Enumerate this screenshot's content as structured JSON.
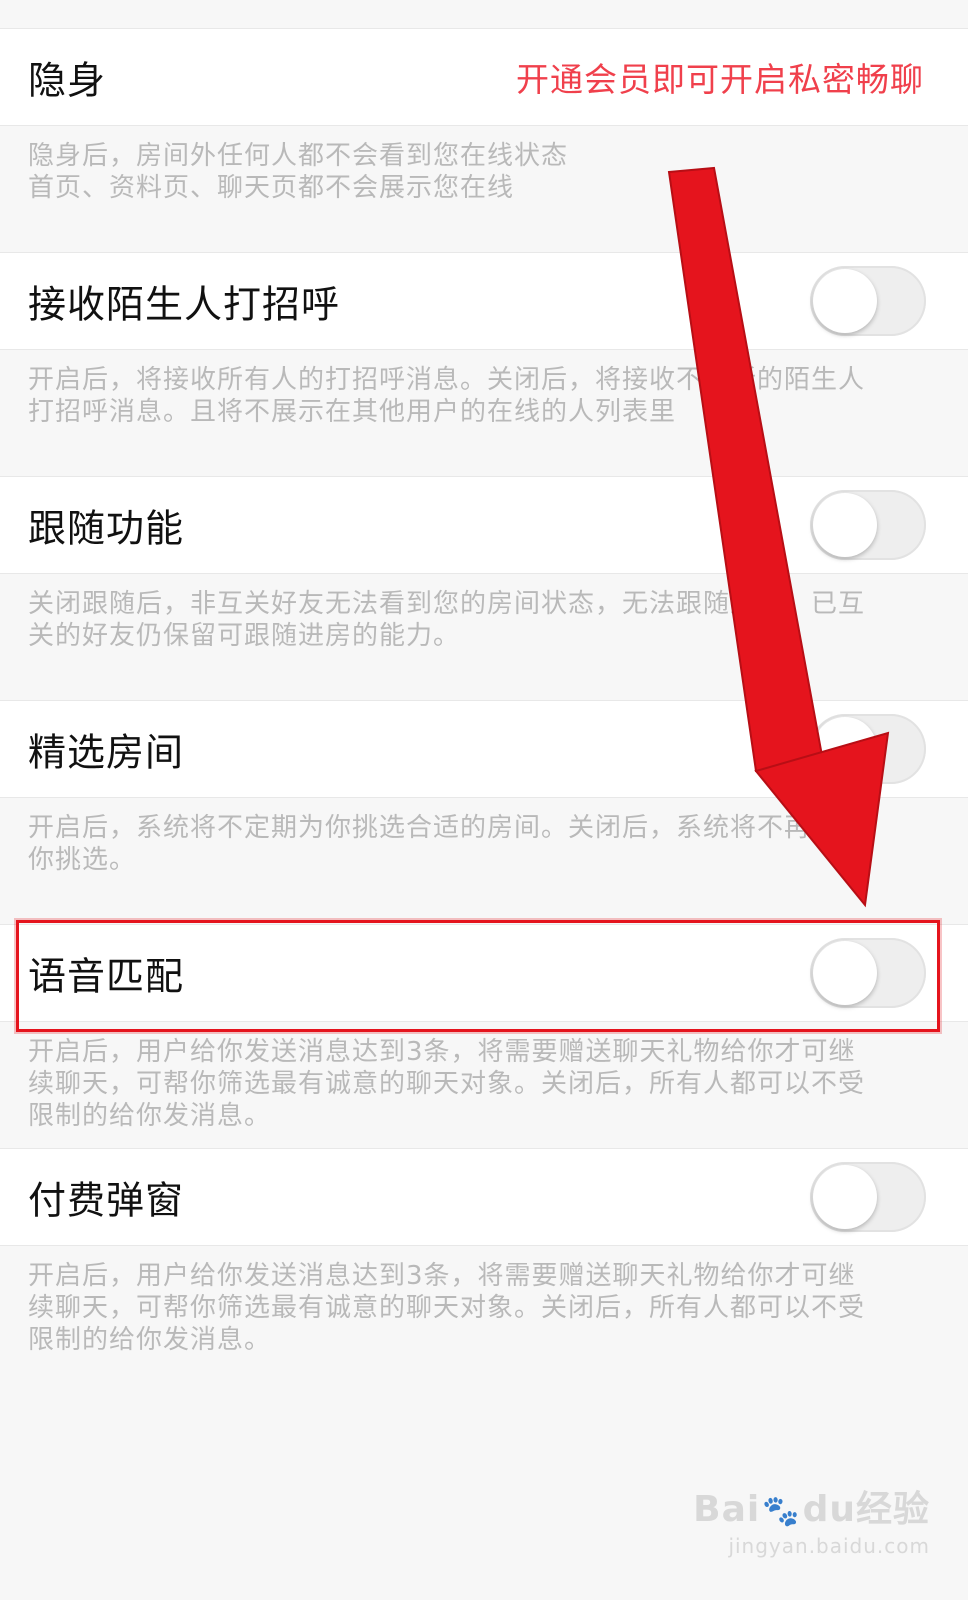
{
  "settings": [
    {
      "title": "隐身",
      "vip_hint": "开通会员即可开启私密畅聊",
      "description": [
        "隐身后，房间外任何人都不会看到您在线状态",
        "首页、资料页、聊天页都不会展示您在线"
      ]
    },
    {
      "title": "接收陌生人打招呼",
      "toggle": "off",
      "description": [
        "开启后，将接收所有人的打招呼消息。关闭后，将接收不到新的陌生人",
        "打招呼消息。且将不展示在其他用户的在线的人列表里"
      ]
    },
    {
      "title": "跟随功能",
      "toggle": "off",
      "description": [
        "关闭跟随后，非互关好友无法看到您的房间状态，无法跟随进房。已互",
        "关的好友仍保留可跟随进房的能力。"
      ]
    },
    {
      "title": "精选房间",
      "toggle": "off",
      "description": [
        "开启后，系统将不定期为你挑选合适的房间。关闭后，系统将不再为",
        "你挑选。"
      ]
    },
    {
      "title": "语音匹配",
      "toggle": "off",
      "highlighted": true,
      "description": [
        "开启后，用户给你发送消息达到3条，将需要赠送聊天礼物给你才可继",
        "续聊天，可帮你筛选最有诚意的聊天对象。关闭后，所有人都可以不受",
        "限制的给你发消息。"
      ]
    },
    {
      "title": "付费弹窗",
      "toggle": "off",
      "description": [
        "开启后，用户给你发送消息达到3条，将需要赠送聊天礼物给你才可继",
        "续聊天，可帮你筛选最有诚意的聊天对象。关闭后，所有人都可以不受",
        "限制的给你发消息。"
      ]
    }
  ],
  "annotations": {
    "highlight_color": "#e5141d",
    "arrow_color": "#e5141d"
  },
  "watermark": {
    "brand_left": "Bai",
    "brand_right": "du",
    "brand_cn": "经验",
    "url": "jingyan.baidu.com"
  },
  "colors": {
    "accent": "#f0404c",
    "background": "#f7f7f7",
    "description_text": "#b9b9b9"
  }
}
